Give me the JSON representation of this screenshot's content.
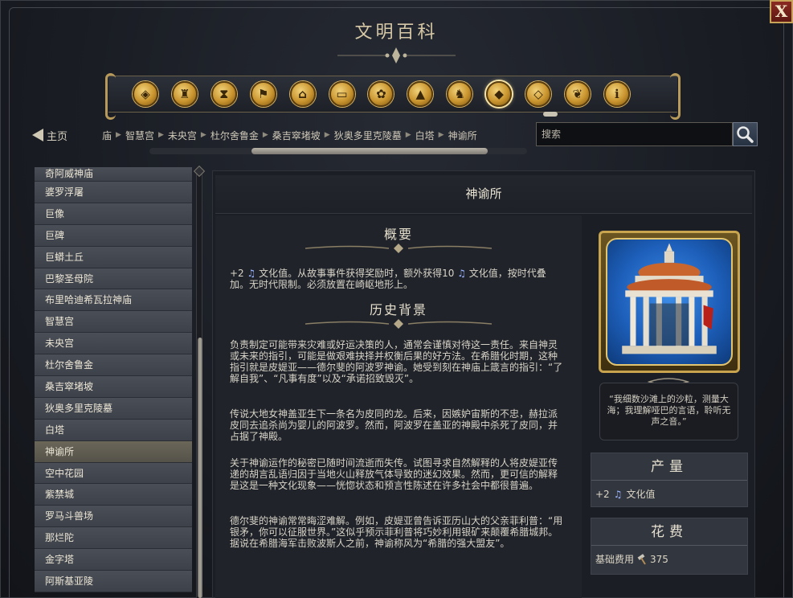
{
  "window": {
    "title": "文明百科",
    "close_label": "X"
  },
  "categories": [
    {
      "name": "concepts-icon",
      "glyph": "◈"
    },
    {
      "name": "civilizations-icon",
      "glyph": "♜"
    },
    {
      "name": "eras-icon",
      "glyph": "⧗"
    },
    {
      "name": "flag-icon",
      "glyph": "⚑"
    },
    {
      "name": "city-states-icon",
      "glyph": "⌂"
    },
    {
      "name": "districts-icon",
      "glyph": "▭"
    },
    {
      "name": "improvements-icon",
      "glyph": "✿"
    },
    {
      "name": "terrain-icon",
      "glyph": "▲"
    },
    {
      "name": "units-icon",
      "glyph": "♞"
    },
    {
      "name": "wonders-icon",
      "glyph": "◆"
    },
    {
      "name": "governments-icon",
      "glyph": "◇"
    },
    {
      "name": "religion-icon",
      "glyph": "❦"
    },
    {
      "name": "info-icon",
      "glyph": "ℹ"
    }
  ],
  "nav": {
    "home_label": "主页",
    "breadcrumbs": [
      "庙",
      "智慧宫",
      "未央宫",
      "杜尔舍鲁金",
      "桑吉窣堵坡",
      "狄奥多里克陵墓",
      "白塔",
      "神谕所"
    ],
    "search_placeholder": "搜索"
  },
  "sidebar": {
    "items": [
      {
        "label": "奇阿威神庙"
      },
      {
        "label": "婆罗浮屠"
      },
      {
        "label": "巨像"
      },
      {
        "label": "巨碑"
      },
      {
        "label": "巨蟒土丘"
      },
      {
        "label": "巴黎圣母院"
      },
      {
        "label": "布里哈迪希瓦拉神庙"
      },
      {
        "label": "智慧宫"
      },
      {
        "label": "未央宫"
      },
      {
        "label": "杜尔舍鲁金"
      },
      {
        "label": "桑吉窣堵坡"
      },
      {
        "label": "狄奥多里克陵墓"
      },
      {
        "label": "白塔"
      },
      {
        "label": "神谕所"
      },
      {
        "label": "空中花园"
      },
      {
        "label": "紫禁城"
      },
      {
        "label": "罗马斗兽场"
      },
      {
        "label": "那烂陀"
      },
      {
        "label": "金字塔"
      },
      {
        "label": "阿斯基亚陵"
      }
    ],
    "active_index": 13
  },
  "article": {
    "title": "神谕所",
    "summary_heading": "概要",
    "summary_p1": "+2 ",
    "summary_p2": " 文化值。从故事事件获得奖励时，额外获得10 ",
    "summary_p3": " 文化值，按时代叠加。无时代限制。必须放置在崎岖地形上。",
    "history_heading": "历史背景",
    "history_paragraphs": [
      "负责制定可能带来灾难或好运决策的人，通常会谨慎对待这一责任。来自神灵或未来的指引，可能是做艰难抉择并权衡后果的好方法。在希腊化时期，这种指引就是皮媞亚——德尔斐的阿波罗神谕。她受到刻在神庙上箴言的指引：“了解自我”、“凡事有度”以及“承诺招致毁灭”。",
      "传说大地女神盖亚生下一条名为皮同的龙。后来，因嫉妒宙斯的不忠，赫拉派皮同去追杀尚为婴儿的阿波罗。然而，阿波罗在盖亚的神殿中杀死了皮同，并占据了神殿。",
      "关于神谕运作的秘密已随时间流逝而失传。试图寻求自然解释的人将皮媞亚传递的胡言乱语归因于当地火山释放气体导致的迷幻效果。然而，更可信的解释是这是一种文化现象——恍惚状态和预言性陈述在许多社会中都很普遍。",
      "德尔斐的神谕常常晦涩难解。例如，皮媞亚曾告诉亚历山大的父亲菲利普：“用银矛，你可以征服世界。”这似乎预示菲利普将巧妙利用银矿来颠覆希腊城邦。据说在希腊海军击败波斯人之前，神谕称风为“希腊的强大盟友”。"
    ]
  },
  "details": {
    "quote": "“我细数沙滩上的沙粒，测量大海；我理解哑巴的言语，聆听无声之音。”",
    "yield_heading": "产量",
    "yield_prefix": "+2",
    "yield_label": "文化值",
    "cost_heading": "花费",
    "cost_label": "基础费用",
    "cost_value": "375"
  },
  "colors": {
    "culture_note": "#9db6ff",
    "gold_trim": "#c8a44e",
    "panel_bg": "#20232a"
  }
}
